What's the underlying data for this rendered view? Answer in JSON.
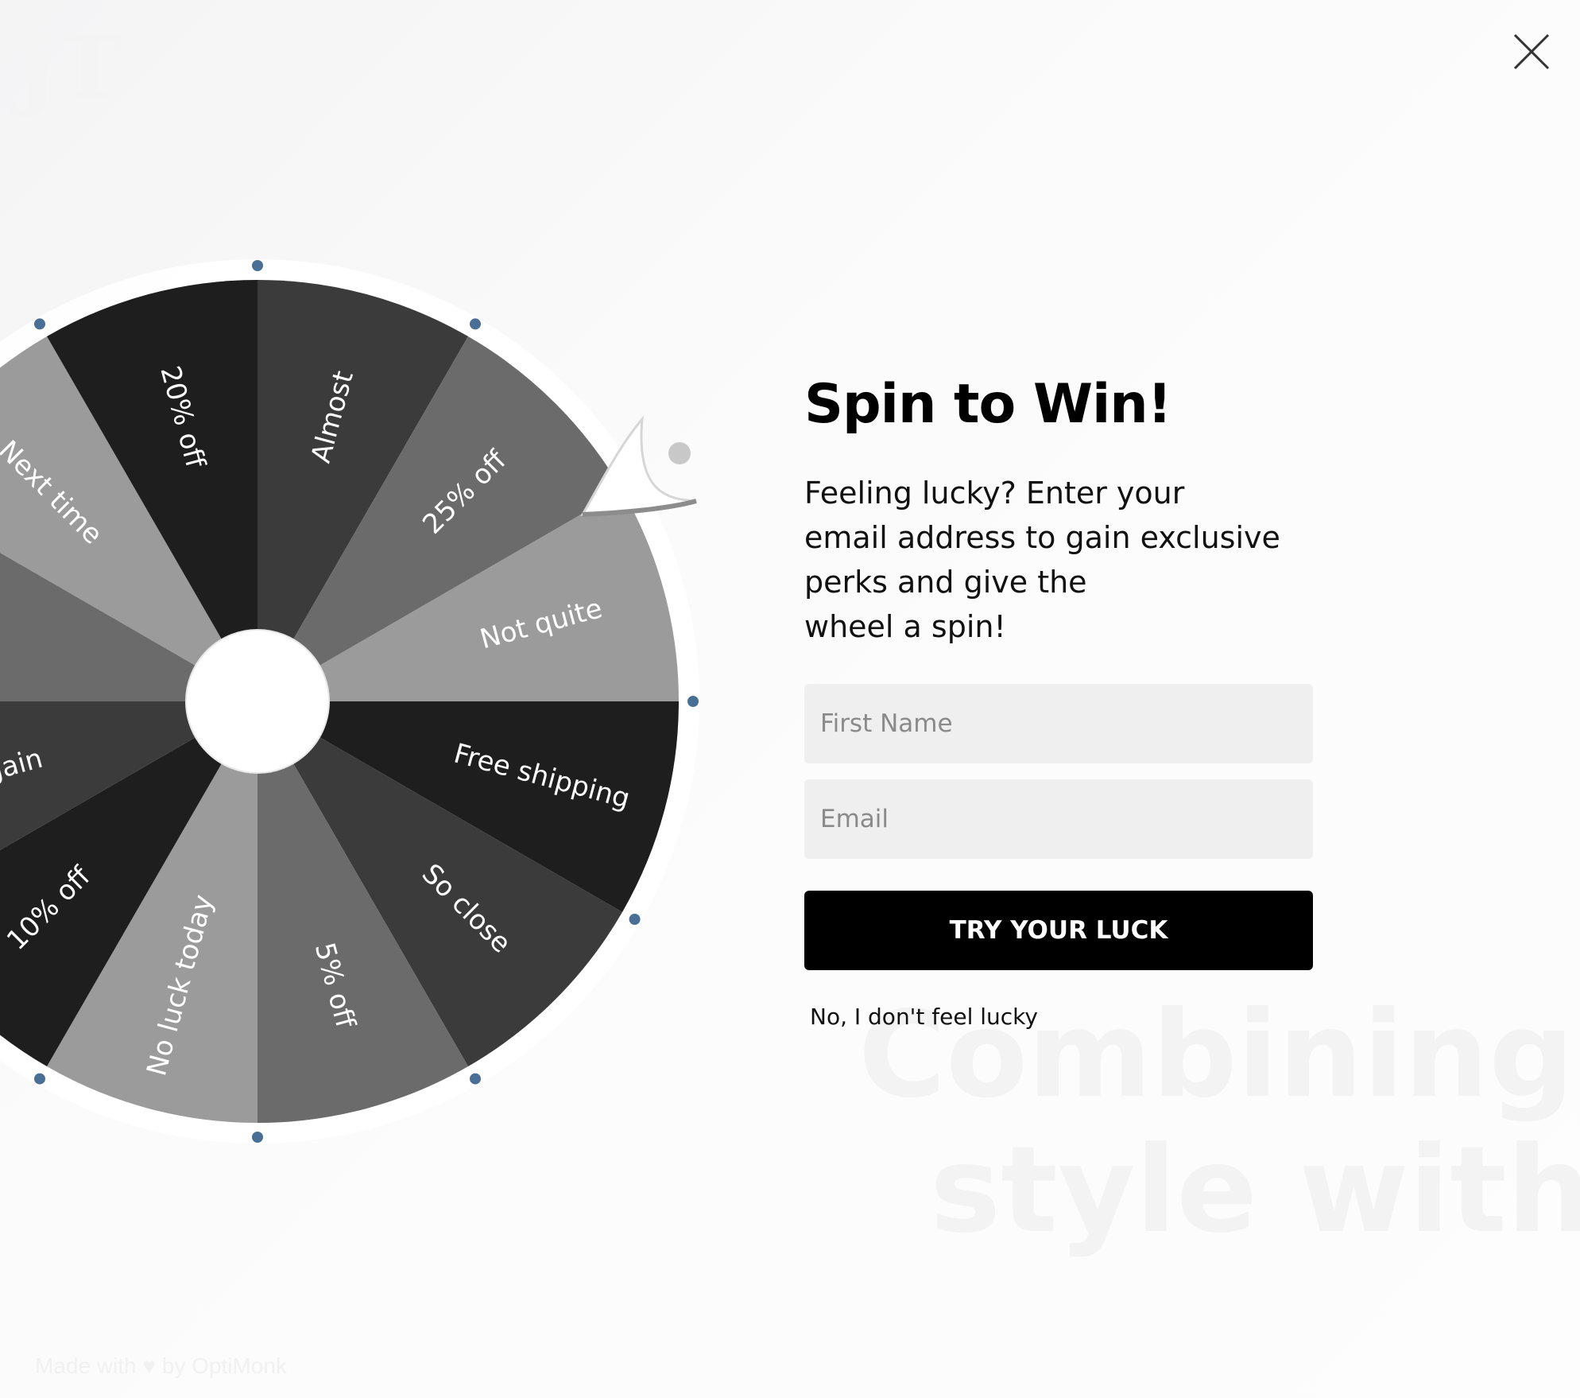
{
  "popup": {
    "close_icon": "close-icon",
    "background_text": [
      "Combining ele",
      "style with sh"
    ]
  },
  "wheel": {
    "segments": [
      {
        "label": "Almost",
        "color": "#3b3b3b"
      },
      {
        "label": "25% off",
        "color": "#6b6b6b"
      },
      {
        "label": "Not quite",
        "color": "#9b9b9b"
      },
      {
        "label": "Free shipping",
        "color": "#1e1e1e"
      },
      {
        "label": "So close",
        "color": "#3b3b3b"
      },
      {
        "label": "5% off",
        "color": "#6b6b6b"
      },
      {
        "label": "No luck today",
        "color": "#9b9b9b"
      },
      {
        "label": "10% off",
        "color": "#1e1e1e"
      },
      {
        "label": "Spin again",
        "color": "#3b3b3b"
      },
      {
        "label": "",
        "color": "#6b6b6b"
      },
      {
        "label": "Next time",
        "color": "#9b9b9b"
      },
      {
        "label": "20% off",
        "color": "#1e1e1e"
      }
    ],
    "peg_color": "#4a6f96",
    "rim_color": "#ffffff",
    "hub_color": "#ffffff",
    "pointer_color": "#ffffff"
  },
  "form": {
    "headline": "Spin to Win!",
    "description": "Feeling lucky? Enter your\nemail address to gain exclusive\nperks and give the\nwheel a spin!",
    "first_name_placeholder": "First Name",
    "email_placeholder": "Email",
    "submit_label": "TRY YOUR LUCK",
    "decline_label": "No, I don't feel lucky"
  },
  "branding": {
    "text": "Made with ♥ by OptiMonk"
  },
  "colors": {
    "button_bg": "#000000",
    "field_bg": "#efefef",
    "text": "#000000"
  }
}
